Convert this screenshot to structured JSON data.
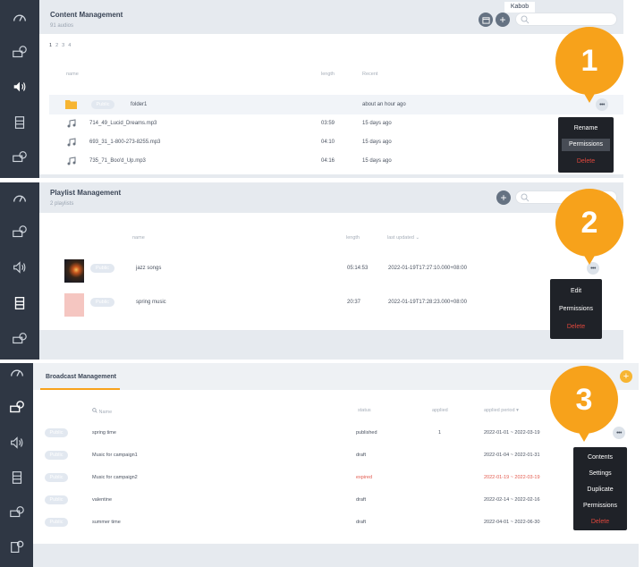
{
  "colors": {
    "accent": "#f7a21b",
    "sidebar": "#2f3744",
    "danger": "#e0473c",
    "menu_bg": "#1f2228"
  },
  "content_mgmt": {
    "title": "Content Management",
    "subtitle": "91 audios",
    "user": "Kabob",
    "pages": [
      "1",
      "2",
      "3",
      "4"
    ],
    "columns": {
      "name": "name",
      "length": "length",
      "recent": "Recent"
    },
    "rows": [
      {
        "badge": "Public",
        "name": "folder1",
        "length": "",
        "recent": "about an hour ago",
        "icon": "folder-icon"
      },
      {
        "name": "714_49_Lucid_Dreams.mp3",
        "length": "03:59",
        "recent": "15 days ago",
        "icon": "music-note-icon"
      },
      {
        "name": "693_31_1-800-273-8255.mp3",
        "length": "04:10",
        "recent": "15 days ago",
        "icon": "music-note-icon"
      },
      {
        "name": "735_71_Boo'd_Up.mp3",
        "length": "04:16",
        "recent": "15 days ago",
        "icon": "music-note-icon"
      }
    ],
    "menu": {
      "rename": "Rename",
      "permissions": "Permissions",
      "delete": "Delete"
    },
    "step": "1"
  },
  "playlist_mgmt": {
    "title": "Playlist Management",
    "subtitle": "2 playlists",
    "columns": {
      "name": "name",
      "length": "length",
      "updated": "last updated"
    },
    "rows": [
      {
        "badge": "Public",
        "name": "jazz songs",
        "length": "05:14:53",
        "updated": "2022-01-19T17:27:10.000+08:00"
      },
      {
        "badge": "Public",
        "name": "spring music",
        "length": "20:37",
        "updated": "2022-01-19T17:28:23.000+08:00"
      }
    ],
    "menu": {
      "edit": "Edit",
      "permissions": "Permissions",
      "delete": "Delete"
    },
    "step": "2"
  },
  "broadcast_mgmt": {
    "tab": "Broadcast Management",
    "columns": {
      "name": "Name",
      "status": "status",
      "applied": "applied",
      "period": "applied period"
    },
    "rows": [
      {
        "badge": "Public",
        "name": "spring time",
        "status": "published",
        "applied": "1",
        "period": "2022-01-01 ~ 2022-03-19",
        "state": "normal"
      },
      {
        "badge": "Public",
        "name": "Music for campaign1",
        "status": "draft",
        "applied": "",
        "period": "2022-01-04 ~ 2022-01-31",
        "state": "normal"
      },
      {
        "badge": "Public",
        "name": "Music for campaign2",
        "status": "expired",
        "applied": "",
        "period": "2022-01-19 ~ 2022-03-19",
        "state": "expired"
      },
      {
        "badge": "Public",
        "name": "valentine",
        "status": "draft",
        "applied": "",
        "period": "2022-02-14 ~ 2022-02-16",
        "state": "normal"
      },
      {
        "badge": "Public",
        "name": "summer time",
        "status": "draft",
        "applied": "",
        "period": "2022-04-01 ~ 2022-06-30",
        "state": "normal"
      }
    ],
    "menu": {
      "contents": "Contents",
      "settings": "Settings",
      "duplicate": "Duplicate",
      "permissions": "Permissions",
      "delete": "Delete"
    },
    "step": "3"
  }
}
